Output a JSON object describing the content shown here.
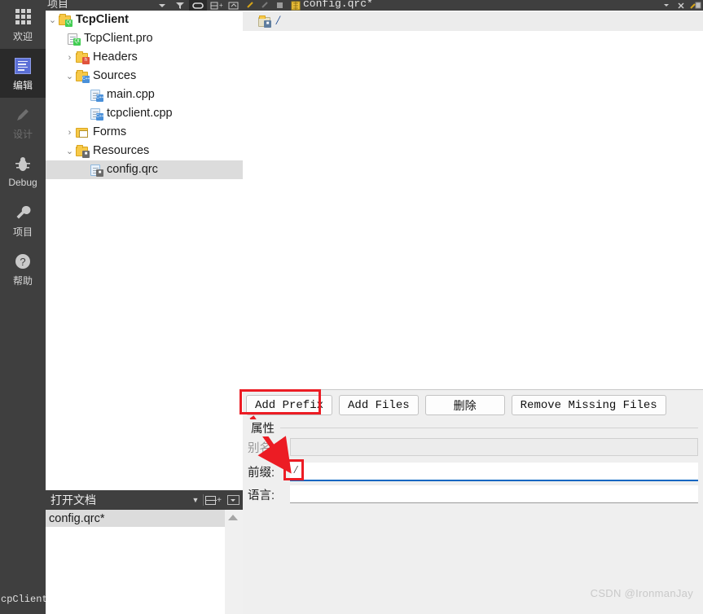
{
  "modebar": {
    "items": [
      {
        "label": "欢迎",
        "icon": "grid-dots-icon",
        "state": "normal"
      },
      {
        "label": "编辑",
        "icon": "edit-document-icon",
        "state": "active"
      },
      {
        "label": "设计",
        "icon": "pencil-icon",
        "state": "disabled"
      },
      {
        "label": "Debug",
        "icon": "bug-icon",
        "state": "normal"
      },
      {
        "label": "项目",
        "icon": "wrench-icon",
        "state": "normal"
      },
      {
        "label": "帮助",
        "icon": "question-circle-icon",
        "state": "normal"
      }
    ],
    "bottom_project_label": "cpClient"
  },
  "tree_pane": {
    "header_title": "项目",
    "header_icons": [
      "chevron-down-icon",
      "filter-icon",
      "link-icon",
      "split-add-icon",
      "collapse-icon"
    ],
    "items": [
      {
        "label": "TcpClient",
        "indent": 0,
        "arrow": "v",
        "icon": "folder-qt-icon",
        "bold": true,
        "selected": false
      },
      {
        "label": "TcpClient.pro",
        "indent": 1,
        "arrow": "",
        "icon": "file-qt-icon",
        "bold": false,
        "selected": false
      },
      {
        "label": "Headers",
        "indent": 1,
        "arrow": ">",
        "icon": "folder-h-icon",
        "bold": false,
        "selected": false
      },
      {
        "label": "Sources",
        "indent": 1,
        "arrow": "v",
        "icon": "folder-cpp-icon",
        "bold": false,
        "selected": false
      },
      {
        "label": "main.cpp",
        "indent": 2,
        "arrow": "",
        "icon": "file-cpp-icon",
        "bold": false,
        "selected": false
      },
      {
        "label": "tcpclient.cpp",
        "indent": 2,
        "arrow": "",
        "icon": "file-cpp-icon",
        "bold": false,
        "selected": false
      },
      {
        "label": "Forms",
        "indent": 1,
        "arrow": ">",
        "icon": "folder-form-icon",
        "bold": false,
        "selected": false
      },
      {
        "label": "Resources",
        "indent": 1,
        "arrow": "v",
        "icon": "folder-res-icon",
        "bold": false,
        "selected": false
      },
      {
        "label": "config.qrc",
        "indent": 2,
        "arrow": "",
        "icon": "file-qrc-icon",
        "bold": false,
        "selected": true
      }
    ]
  },
  "open_documents": {
    "title": "打开文档",
    "icons": [
      "chevron-down-icon",
      "split-icon",
      "dropdown-box-icon"
    ],
    "items": [
      {
        "label": "config.qrc*",
        "selected": true
      }
    ]
  },
  "editor": {
    "tab_label": "config.qrc*",
    "tab_icons_left": [
      "back-arrow-icon",
      "forward-arrow-icon",
      "bookmark-icon",
      "qrc-file-icon"
    ],
    "tab_icons_right": [
      "chevron-down-icon",
      "close-icon",
      "split-editor-icon"
    ],
    "resource_tree": [
      {
        "label": "/",
        "icon": "qrc-prefix-folder-icon"
      }
    ]
  },
  "panel": {
    "buttons": [
      {
        "label": "Add Prefix",
        "font": "mono",
        "highlighted": true
      },
      {
        "label": "Add Files",
        "font": "mono",
        "highlighted": false
      },
      {
        "label": "删除",
        "font": "cn",
        "highlighted": false
      },
      {
        "label": "Remove Missing Files",
        "font": "mono",
        "highlighted": false
      }
    ],
    "properties": {
      "group_title": "属性",
      "fields": [
        {
          "label": "别名:",
          "value": "",
          "state": "disabled"
        },
        {
          "label": "前缀:",
          "value": "/",
          "state": "focused"
        },
        {
          "label": "语言:",
          "value": "",
          "state": "normal"
        }
      ]
    }
  },
  "annotations": {
    "arrow_color": "#ec1c24",
    "box_color": "#ec1c24",
    "description": "red box around Add Prefix button and around the prefix value, arrow connecting them"
  },
  "watermark": {
    "text": "CSDN @IronmanJay"
  }
}
